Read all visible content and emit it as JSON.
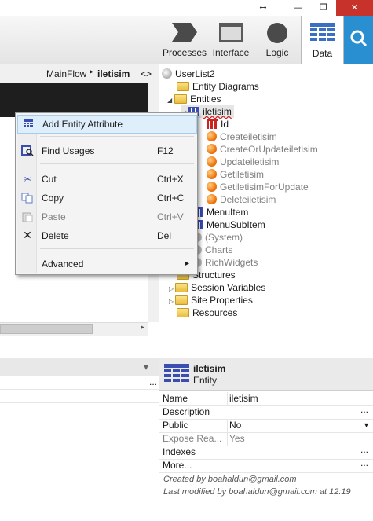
{
  "window": {
    "restore_icon": "↔",
    "minimize_icon": "—",
    "maximize_icon": "❐",
    "close_icon": "✕"
  },
  "toolbar": {
    "processes_label": "Processes",
    "interface_label": "Interface",
    "logic_label": "Logic",
    "data_label": "Data",
    "colors": {
      "search_bg": "#2a8fd0",
      "data_icon": "#3a6fc4"
    }
  },
  "breadcrumb": {
    "flow": "MainFlow",
    "sep": "▸",
    "screen": "iletisim",
    "toggle": "<>"
  },
  "context_menu": {
    "items": [
      {
        "label": "Add Entity Attribute",
        "shortcut": "",
        "icon": "add-attribute-icon"
      },
      {
        "label": "Find Usages",
        "shortcut": "F12",
        "icon": "find-usages-icon"
      },
      {
        "label": "Cut",
        "shortcut": "Ctrl+X",
        "icon": "scissors-icon"
      },
      {
        "label": "Copy",
        "shortcut": "Ctrl+C",
        "icon": "copy-icon"
      },
      {
        "label": "Paste",
        "shortcut": "Ctrl+V",
        "icon": "paste-icon"
      },
      {
        "label": "Delete",
        "shortcut": "Del",
        "icon": "delete-icon"
      },
      {
        "label": "Advanced",
        "shortcut": "",
        "icon": ""
      }
    ],
    "submenu_arrow": "▸"
  },
  "tree": {
    "root": "UserList2",
    "entity_diagrams": "Entity Diagrams",
    "entities": "Entities",
    "entity": "iletisim",
    "attr": "Id",
    "actions": [
      "Createiletisim",
      "CreateOrUpdateiletisim",
      "Updateiletisim",
      "Getiletisim",
      "GetiletisimForUpdate",
      "Deleteiletisim"
    ],
    "menu_item": "MenuItem",
    "menu_sub_item": "MenuSubItem",
    "system": "(System)",
    "charts": "Charts",
    "rich_widgets": "RichWidgets",
    "structures": "Structures",
    "session_variables": "Session Variables",
    "site_properties": "Site Properties",
    "resources": "Resources"
  },
  "properties": {
    "title": "iletisim",
    "subtitle": "Entity",
    "rows": [
      {
        "name": "Name",
        "value": ""
      },
      {
        "name": "Description",
        "value": ""
      },
      {
        "name": "Public",
        "value": "No"
      },
      {
        "name": "Expose Rea...",
        "value": "Yes"
      },
      {
        "name": "Indexes",
        "value": ""
      },
      {
        "name": "More...",
        "value": ""
      }
    ],
    "name_value": "iletisim",
    "ellipsis": "...",
    "dropdown": "▾",
    "created_by": "Created by boahaldun@gmail.com",
    "modified_by": "Last modified by boahaldun@gmail.com at 12:19"
  },
  "lower_left": {
    "dropdown": "▾",
    "ellipsis": "..."
  }
}
